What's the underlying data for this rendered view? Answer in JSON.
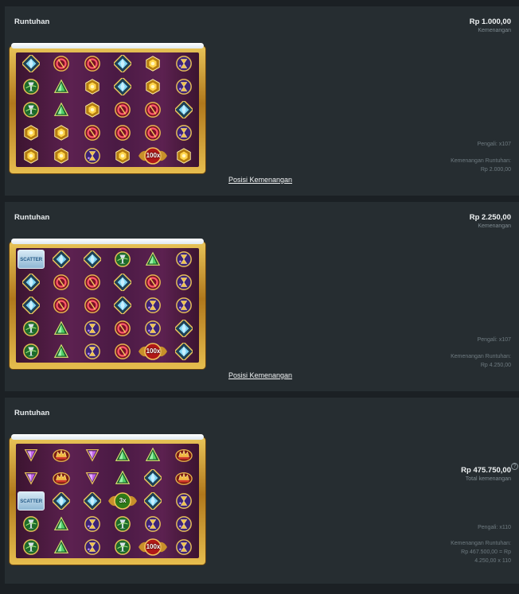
{
  "panels": [
    {
      "title": "Runtuhan",
      "amount": "Rp 1.000,00",
      "amount_label": "Kemenangan",
      "multiplier_line": "Pengali: x107",
      "cascade_label": "Kemenangan Runtuhan:",
      "cascade_value": "Rp 2.000,00",
      "link": "Posisi Kemenangan",
      "grid": [
        [
          "blue-gem",
          "red-ring",
          "red-ring",
          "blue-gem",
          "gold-hex",
          "purple-hourglass"
        ],
        [
          "green-chalice",
          "green-gem",
          "gold-hex",
          "blue-gem",
          "gold-hex",
          "purple-hourglass"
        ],
        [
          "green-chalice",
          "green-gem",
          "gold-hex",
          "red-ring",
          "red-ring",
          "blue-gem"
        ],
        [
          "gold-hex",
          "gold-hex",
          "red-ring",
          "red-ring",
          "red-ring",
          "purple-hourglass"
        ],
        [
          "gold-hex",
          "gold-hex",
          "purple-hourglass",
          "gold-hex",
          "multiplier-100x",
          "gold-hex"
        ]
      ]
    },
    {
      "title": "Runtuhan",
      "amount": "Rp 2.250,00",
      "amount_label": "Kemenangan",
      "multiplier_line": "Pengali: x107",
      "cascade_label": "Kemenangan Runtuhan:",
      "cascade_value": "Rp 4.250,00",
      "link": "Posisi Kemenangan",
      "grid": [
        [
          "scatter",
          "blue-gem",
          "blue-gem",
          "green-chalice",
          "green-gem",
          "purple-hourglass"
        ],
        [
          "blue-gem",
          "red-ring",
          "red-ring",
          "blue-gem",
          "red-ring",
          "purple-hourglass"
        ],
        [
          "blue-gem",
          "red-ring",
          "red-ring",
          "blue-gem",
          "purple-hourglass",
          "purple-hourglass"
        ],
        [
          "green-chalice",
          "green-gem",
          "purple-hourglass",
          "red-ring",
          "purple-hourglass",
          "blue-gem"
        ],
        [
          "green-chalice",
          "green-gem",
          "purple-hourglass",
          "red-ring",
          "multiplier-100x",
          "blue-gem"
        ]
      ]
    },
    {
      "title": "Runtuhan",
      "amount": "Rp 475.750,00",
      "amount_label": "Total kemenangan",
      "multiplier_line": "Pengali: x110",
      "cascade_label": "Kemenangan Runtuhan:",
      "cascade_value": "Rp 467.500,00 = Rp",
      "cascade_value2": "4.250,00 x 110",
      "grid": [
        [
          "purple-gem",
          "red-crown",
          "purple-gem",
          "green-gem",
          "green-gem",
          "red-crown"
        ],
        [
          "purple-gem",
          "red-crown",
          "purple-gem",
          "green-gem",
          "blue-gem",
          "red-crown"
        ],
        [
          "scatter",
          "blue-gem",
          "blue-gem",
          "multiplier-3x",
          "blue-gem",
          "purple-hourglass"
        ],
        [
          "green-chalice",
          "green-gem",
          "purple-hourglass",
          "green-chalice",
          "purple-hourglass",
          "purple-hourglass"
        ],
        [
          "green-chalice",
          "green-gem",
          "purple-hourglass",
          "green-chalice",
          "multiplier-100x",
          "purple-hourglass"
        ]
      ]
    }
  ],
  "symbols": {
    "scatter": "SCATTER",
    "multiplier-100x": "100x",
    "multiplier-3x": "3x"
  }
}
